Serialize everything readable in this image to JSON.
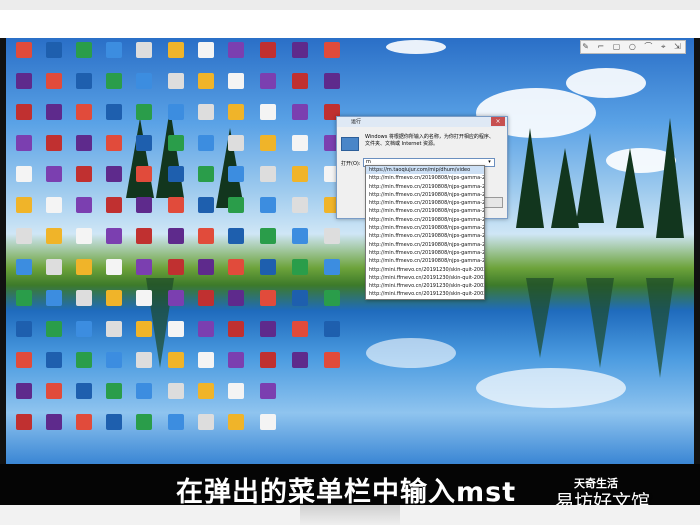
{
  "toolbar": {
    "icons": "✎ ⌐ ▢ ○ ⌒ ⌖ ⇲"
  },
  "run_dialog": {
    "title": "运行",
    "close": "×",
    "description": "Windows 将根据你所输入的名称，为你打开相应的程序、文件夹、文档或 Internet 资源。",
    "open_label": "打开(O):",
    "input_value": "m",
    "dropdown_glyph": "▾"
  },
  "autocomplete": [
    "https://m.taoqiujur.com/mip/dhum/video",
    "http://min.ffmevo.cn/20190808/njps-gamma-20",
    "http://min.ffmevo.cn/20190808/njps-gamma-20",
    "http://min.ffmevo.cn/20190808/njps-gamma-20",
    "http://min.ffmevo.cn/20190808/njps-gamma-20",
    "http://min.ffmevo.cn/20190808/njps-gamma-20",
    "http://min.ffmevo.cn/20190808/njps-gamma-20",
    "http://min.ffmevo.cn/20190808/njps-gamma-20",
    "http://min.ffmevo.cn/20190808/njps-gamma-20",
    "http://min.ffmevo.cn/20190808/njps-gamma-20",
    "http://min.ffmevo.cn/20190808/njps-gamma-20",
    "http://min.ffmevo.cn/20190808/njps-gamma-20",
    "http://mini.ffmevo.cn/20191230/skin-quit-2002",
    "http://mini.ffmevo.cn/20191230/skin-quit-2002",
    "http://mini.ffmevo.cn/20191230/skin-quit-2002",
    "http://mini.ffmevo.cn/20191230/skin-quit-2002"
  ],
  "caption": "在弹出的菜单栏中输入mst",
  "watermark_small": "天奇生活",
  "watermark_large": "易坊好文馆",
  "colors": {
    "caption_band": "#050505",
    "dialog_border": "#7a9cc6",
    "close_red": "#c75050"
  }
}
